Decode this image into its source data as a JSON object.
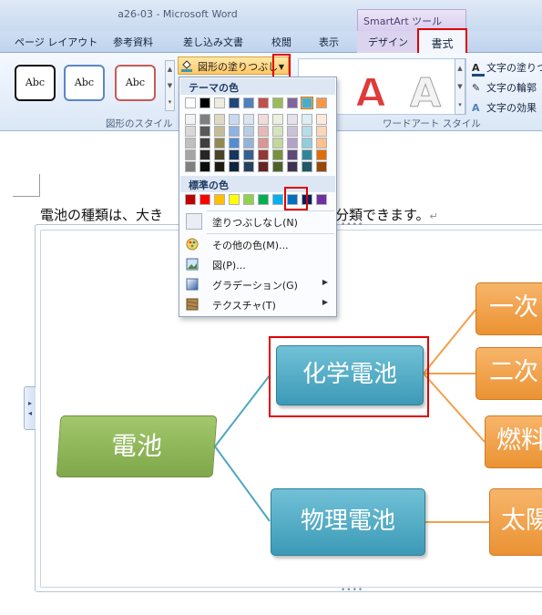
{
  "window": {
    "title": "a26-03 - Microsoft Word",
    "smartart_tools": "SmartArt ツール"
  },
  "tabs": [
    "ページ レイアウト",
    "参考資料",
    "差し込み文書",
    "校閲",
    "表示",
    "デザイン",
    "書式"
  ],
  "ribbon": {
    "shape_style_sample": "Abc",
    "shape_styles_group": "図形のスタイル",
    "shape_fill_button": "図形の塗りつぶし",
    "wordart_group": "ワードアート スタイル",
    "wordart_letter": "A",
    "text_fill": "文字の塗りつ",
    "text_outline": "文字の輪郭",
    "text_effects": "文字の効果"
  },
  "fill_menu": {
    "theme_colors_header": "テーマの色",
    "standard_colors_header": "標準の色",
    "no_fill": "塗りつぶしなし(N)",
    "more_colors": "その他の色(M)...",
    "picture": "図(P)...",
    "gradient": "グラデーション(G)",
    "texture": "テクスチャ(T)",
    "theme_colors": [
      "#ffffff",
      "#000000",
      "#eeece1",
      "#1f497d",
      "#4f81bd",
      "#c0504d",
      "#9bbb59",
      "#8064a2",
      "#4bacc6",
      "#f79646"
    ],
    "theme_shades": [
      [
        "#f2f2f2",
        "#7f7f7f",
        "#ddd9c3",
        "#c6d9f0",
        "#dbe5f1",
        "#f2dcdb",
        "#ebf1dd",
        "#e5e0ec",
        "#dbeef3",
        "#fdeada"
      ],
      [
        "#d8d8d8",
        "#595959",
        "#c4bd97",
        "#8db3e2",
        "#b8cce4",
        "#e5b9b7",
        "#d7e3bc",
        "#ccc1d9",
        "#b7dde8",
        "#fbd5b5"
      ],
      [
        "#bfbfbf",
        "#3f3f3f",
        "#938953",
        "#548dd4",
        "#95b3d7",
        "#d99694",
        "#c3d69b",
        "#b2a2c7",
        "#92cddc",
        "#fac08f"
      ],
      [
        "#a5a5a5",
        "#262626",
        "#494429",
        "#17365d",
        "#366092",
        "#953734",
        "#76923c",
        "#5f497a",
        "#31859b",
        "#e36c09"
      ],
      [
        "#7f7f7f",
        "#0c0c0c",
        "#1d1b10",
        "#0f243e",
        "#244061",
        "#632423",
        "#4f6128",
        "#3f3151",
        "#205867",
        "#974806"
      ]
    ],
    "standard_colors": [
      "#c00000",
      "#ff0000",
      "#ffc000",
      "#ffff00",
      "#92d050",
      "#00b050",
      "#00b0f0",
      "#0070c0",
      "#002060",
      "#7030a0"
    ],
    "selected_standard_index": 7
  },
  "document": {
    "paragraph_start": "電池の種類は、大き",
    "paragraph_end": "分類できます。",
    "paragraph_mark": "↵"
  },
  "smartart": {
    "root": "電池",
    "chemical": "化学電池",
    "physical": "物理電池",
    "chemical_children": [
      "一次",
      "二次",
      "燃料"
    ],
    "physical_children": [
      "太陽"
    ]
  }
}
